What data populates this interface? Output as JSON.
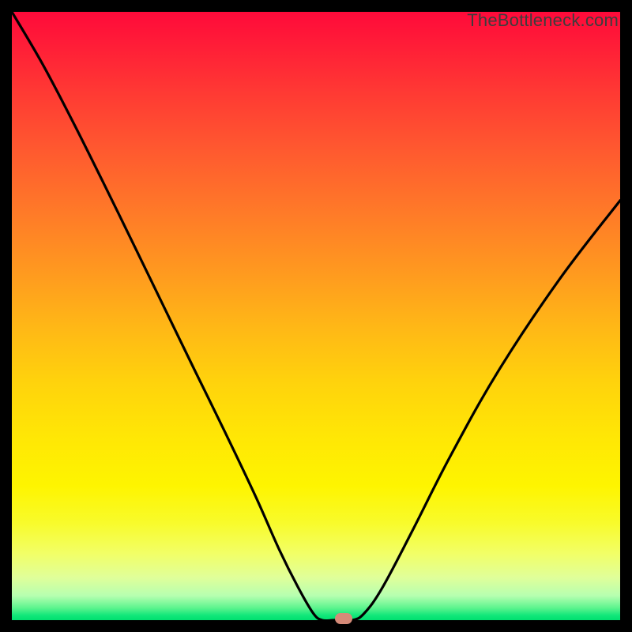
{
  "attribution": "TheBottleneck.com",
  "chart_data": {
    "type": "line",
    "title": "",
    "xlabel": "",
    "ylabel": "",
    "xlim": [
      0,
      1
    ],
    "ylim": [
      0,
      1
    ],
    "series": [
      {
        "name": "bottleneck-curve",
        "x": [
          0.0,
          0.05,
          0.1,
          0.15,
          0.2,
          0.25,
          0.3,
          0.35,
          0.4,
          0.44,
          0.47,
          0.495,
          0.51,
          0.53,
          0.56,
          0.58,
          0.61,
          0.66,
          0.72,
          0.8,
          0.9,
          1.0
        ],
        "y": [
          1.0,
          0.915,
          0.82,
          0.72,
          0.618,
          0.515,
          0.412,
          0.31,
          0.205,
          0.115,
          0.055,
          0.012,
          0.0,
          0.0,
          0.0,
          0.012,
          0.055,
          0.15,
          0.268,
          0.41,
          0.56,
          0.69
        ]
      }
    ],
    "annotations": [
      {
        "name": "optimal-marker",
        "x": 0.545,
        "y": 0.003
      }
    ],
    "background_gradient": {
      "top_color": "#ff0a3a",
      "mid_color": "#ffe705",
      "bottom_color": "#00df6f"
    }
  }
}
